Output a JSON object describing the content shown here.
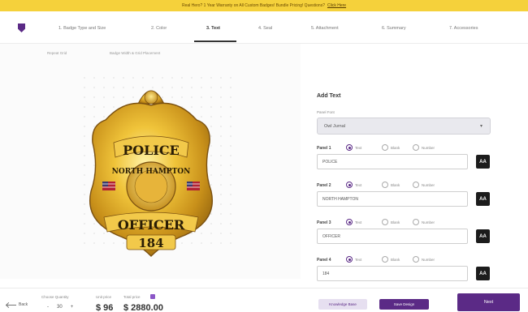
{
  "banner": {
    "text": "Real Hero? 1 Year Warranty on All Custom Badges! Bundle Pricing! Questions?",
    "link": "Click Here"
  },
  "steps": [
    {
      "label": "1. Badge Type and Size"
    },
    {
      "label": "2. Color"
    },
    {
      "label": "3. Text"
    },
    {
      "label": "4. Seal"
    },
    {
      "label": "5. Attachment"
    },
    {
      "label": "6. Summary"
    },
    {
      "label": "7. Accessories"
    }
  ],
  "preview": {
    "view_labels": [
      "Repeat Grid",
      "Badge Width & Grid Placement"
    ],
    "badge_text": {
      "top": "POLICE",
      "arc": "NORTH HAMPTON",
      "bottom": "OFFICER",
      "number": "184"
    }
  },
  "add_text": {
    "title": "Add Text",
    "font_label": "Panel Font",
    "font_value": "Owl Jurnal",
    "option_labels": [
      "Text",
      "Blank",
      "Number"
    ],
    "panels": [
      {
        "label": "Panel 1",
        "value": "POLICE",
        "selected": "Text"
      },
      {
        "label": "Panel 2",
        "value": "NORTH HAMPTON",
        "selected": "Text"
      },
      {
        "label": "Panel 3",
        "value": "OFFICER",
        "selected": "Text"
      },
      {
        "label": "Panel 4",
        "value": "184",
        "selected": "Text"
      }
    ],
    "aa_label": "AA"
  },
  "footer": {
    "back": "Back",
    "qty_label": "Choose Quantity",
    "qty_minus": "-",
    "qty_value": "30",
    "qty_plus": "+",
    "unit_price_label": "Unit price",
    "total_price_label": "Total price",
    "unit_price": "$ 96",
    "total_price": "$ 2880.00",
    "knowledge_button": "Knowledge Base",
    "save_button": "Save Design",
    "next_button": "Next"
  },
  "colors": {
    "accent": "#5b2a86",
    "banner": "#f5d13b",
    "badge_gold": "#d9a520",
    "badge_text": "#2a1d05"
  }
}
